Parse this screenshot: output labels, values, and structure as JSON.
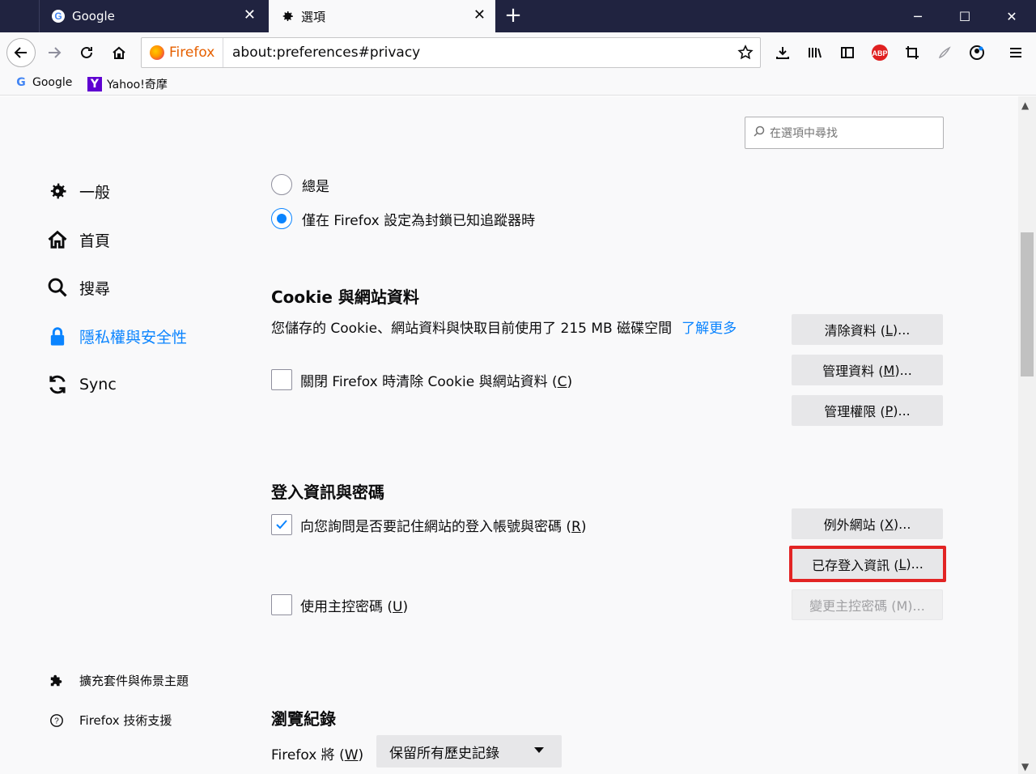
{
  "tabs": [
    {
      "title": "Google",
      "icon": "google-g-icon"
    },
    {
      "title": "選項",
      "icon": "gear-icon"
    }
  ],
  "navbar": {
    "identity_label": "Firefox",
    "url": "about:preferences#privacy"
  },
  "bookmarks": [
    {
      "label": "Google",
      "icon": "google-g-icon"
    },
    {
      "label": "Yahoo!奇摩",
      "icon": "yahoo-y-icon"
    }
  ],
  "search": {
    "placeholder": "在選項中尋找"
  },
  "sidebar": {
    "categories": [
      {
        "label": "一般",
        "icon": "gear-icon"
      },
      {
        "label": "首頁",
        "icon": "home-icon"
      },
      {
        "label": "搜尋",
        "icon": "search-icon"
      },
      {
        "label": "隱私權與安全性",
        "icon": "lock-icon",
        "selected": true
      },
      {
        "label": "Sync",
        "icon": "sync-icon"
      }
    ],
    "footer": [
      {
        "label": "擴充套件與佈景主題",
        "icon": "puzzle-icon"
      },
      {
        "label": "Firefox 技術支援",
        "icon": "help-icon"
      }
    ]
  },
  "tracking": {
    "option_always": "總是",
    "option_only_blocking": "僅在 Firefox 設定為封鎖已知追蹤器時",
    "selected": "option_only_blocking"
  },
  "cookies": {
    "heading": "Cookie 與網站資料",
    "usage_text": "您儲存的 Cookie、網站資料與快取目前使用了 215 MB 磁碟空間",
    "learn_more": "了解更多",
    "clear_on_close_pre": "關閉 Firefox 時清除 Cookie 與網站資料 (",
    "clear_on_close_key": "C",
    "clear_on_close_post": ")",
    "clear_on_close_checked": false,
    "buttons": {
      "clear_pre": "清除資料 (",
      "clear_key": "L",
      "clear_post": ")...",
      "manage_pre": "管理資料 (",
      "manage_key": "M",
      "manage_post": ")...",
      "perms_pre": "管理權限 (",
      "perms_key": "P",
      "perms_post": ")..."
    }
  },
  "logins": {
    "heading": "登入資訊與密碼",
    "ask_save_pre": "向您詢問是否要記住網站的登入帳號與密碼 (",
    "ask_save_key": "R",
    "ask_save_post": ")",
    "ask_save_checked": true,
    "master_pw_pre": "使用主控密碼 (",
    "master_pw_key": "U",
    "master_pw_post": ")",
    "master_pw_checked": false,
    "buttons": {
      "exceptions_pre": "例外網站 (",
      "exceptions_key": "X",
      "exceptions_post": ")...",
      "saved_pre": "已存登入資訊 (",
      "saved_key": "L",
      "saved_post": ")...",
      "change_master": "變更主控密碼 (M)..."
    }
  },
  "history": {
    "heading": "瀏覽紀錄",
    "label_pre": "Firefox 將 (",
    "label_key": "W",
    "label_post": ")",
    "selected_option": "保留所有歷史記錄"
  },
  "colors": {
    "accent": "#0a84ff",
    "highlight_border": "#e22424",
    "titlebar": "#202340"
  }
}
